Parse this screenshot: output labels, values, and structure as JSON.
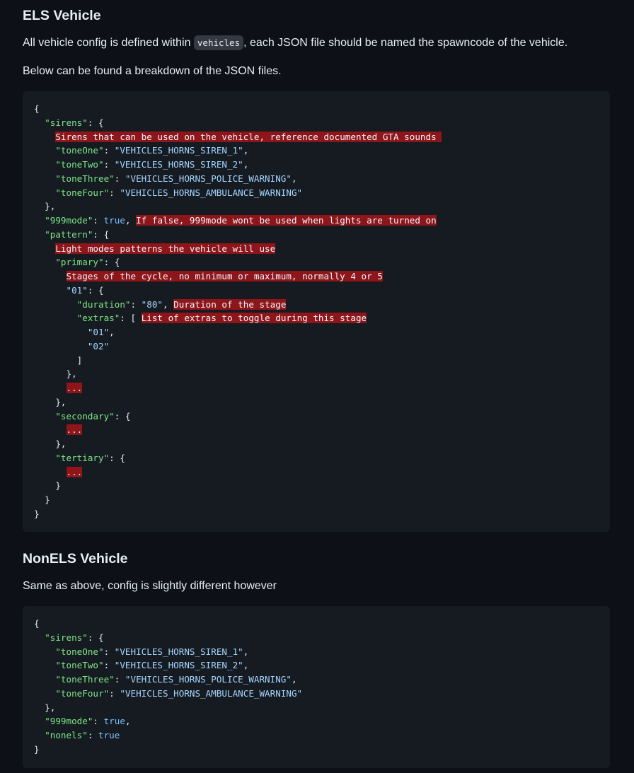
{
  "els": {
    "heading": "ELS Vehicle",
    "intro_before": "All vehicle config is defined within ",
    "intro_code": "vehicles",
    "intro_after": ", each JSON file should be named the spawncode of the vehicle.",
    "breakdown": "Below can be found a breakdown of the JSON files.",
    "code": [
      [
        [
          "p",
          "{"
        ]
      ],
      [
        [
          "p",
          "  "
        ],
        [
          "k",
          "\"sirens\""
        ],
        [
          "p",
          ": {"
        ]
      ],
      [
        [
          "p",
          "    "
        ],
        [
          "err",
          "Sirens that can be used on the vehicle, reference documented GTA sounds "
        ]
      ],
      [
        [
          "p",
          "    "
        ],
        [
          "k",
          "\"toneOne\""
        ],
        [
          "p",
          ": "
        ],
        [
          "s",
          "\"VEHICLES_HORNS_SIREN_1\""
        ],
        [
          "p",
          ","
        ]
      ],
      [
        [
          "p",
          "    "
        ],
        [
          "k",
          "\"toneTwo\""
        ],
        [
          "p",
          ": "
        ],
        [
          "s",
          "\"VEHICLES_HORNS_SIREN_2\""
        ],
        [
          "p",
          ","
        ]
      ],
      [
        [
          "p",
          "    "
        ],
        [
          "k",
          "\"toneThree\""
        ],
        [
          "p",
          ": "
        ],
        [
          "s",
          "\"VEHICLES_HORNS_POLICE_WARNING\""
        ],
        [
          "p",
          ","
        ]
      ],
      [
        [
          "p",
          "    "
        ],
        [
          "k",
          "\"toneFour\""
        ],
        [
          "p",
          ": "
        ],
        [
          "s",
          "\"VEHICLES_HORNS_AMBULANCE_WARNING\""
        ]
      ],
      [
        [
          "p",
          "  },"
        ]
      ],
      [
        [
          "p",
          "  "
        ],
        [
          "k",
          "\"999mode\""
        ],
        [
          "p",
          ": "
        ],
        [
          "c",
          "true"
        ],
        [
          "p",
          ", "
        ],
        [
          "err",
          "If false, 999mode wont be used when lights are turned on"
        ]
      ],
      [
        [
          "p",
          "  "
        ],
        [
          "k",
          "\"pattern\""
        ],
        [
          "p",
          ": {"
        ]
      ],
      [
        [
          "p",
          "    "
        ],
        [
          "err",
          "Light modes patterns the vehicle will use"
        ]
      ],
      [
        [
          "p",
          "    "
        ],
        [
          "k",
          "\"primary\""
        ],
        [
          "p",
          ": {"
        ]
      ],
      [
        [
          "p",
          "      "
        ],
        [
          "err",
          "Stages of the cycle, no minimum or maximum, normally 4 or 5"
        ]
      ],
      [
        [
          "p",
          "      "
        ],
        [
          "s",
          "\"01\""
        ],
        [
          "p",
          ": {"
        ]
      ],
      [
        [
          "p",
          "        "
        ],
        [
          "k",
          "\"duration\""
        ],
        [
          "p",
          ": "
        ],
        [
          "s",
          "\"80\""
        ],
        [
          "p",
          ", "
        ],
        [
          "err",
          "Duration of the stage"
        ]
      ],
      [
        [
          "p",
          "        "
        ],
        [
          "k",
          "\"extras\""
        ],
        [
          "p",
          ": [ "
        ],
        [
          "err",
          "List of extras to toggle during this stage"
        ]
      ],
      [
        [
          "p",
          "          "
        ],
        [
          "s",
          "\"01\""
        ],
        [
          "p",
          ","
        ]
      ],
      [
        [
          "p",
          "          "
        ],
        [
          "s",
          "\"02\""
        ]
      ],
      [
        [
          "p",
          "        ]"
        ]
      ],
      [
        [
          "p",
          "      },"
        ]
      ],
      [
        [
          "p",
          "      "
        ],
        [
          "err",
          "..."
        ]
      ],
      [
        [
          "p",
          "    },"
        ]
      ],
      [
        [
          "p",
          "    "
        ],
        [
          "k",
          "\"secondary\""
        ],
        [
          "p",
          ": {"
        ]
      ],
      [
        [
          "p",
          "      "
        ],
        [
          "err",
          "..."
        ]
      ],
      [
        [
          "p",
          "    },"
        ]
      ],
      [
        [
          "p",
          "    "
        ],
        [
          "k",
          "\"tertiary\""
        ],
        [
          "p",
          ": {"
        ]
      ],
      [
        [
          "p",
          "      "
        ],
        [
          "err",
          "..."
        ]
      ],
      [
        [
          "p",
          "    }"
        ]
      ],
      [
        [
          "p",
          "  }"
        ]
      ],
      [
        [
          "p",
          "}"
        ]
      ]
    ]
  },
  "nonels": {
    "heading": "NonELS Vehicle",
    "intro": "Same as above, config is slightly different however",
    "code": [
      [
        [
          "p",
          "{"
        ]
      ],
      [
        [
          "p",
          "  "
        ],
        [
          "k",
          "\"sirens\""
        ],
        [
          "p",
          ": {"
        ]
      ],
      [
        [
          "p",
          "    "
        ],
        [
          "k",
          "\"toneOne\""
        ],
        [
          "p",
          ": "
        ],
        [
          "s",
          "\"VEHICLES_HORNS_SIREN_1\""
        ],
        [
          "p",
          ","
        ]
      ],
      [
        [
          "p",
          "    "
        ],
        [
          "k",
          "\"toneTwo\""
        ],
        [
          "p",
          ": "
        ],
        [
          "s",
          "\"VEHICLES_HORNS_SIREN_2\""
        ],
        [
          "p",
          ","
        ]
      ],
      [
        [
          "p",
          "    "
        ],
        [
          "k",
          "\"toneThree\""
        ],
        [
          "p",
          ": "
        ],
        [
          "s",
          "\"VEHICLES_HORNS_POLICE_WARNING\""
        ],
        [
          "p",
          ","
        ]
      ],
      [
        [
          "p",
          "    "
        ],
        [
          "k",
          "\"toneFour\""
        ],
        [
          "p",
          ": "
        ],
        [
          "s",
          "\"VEHICLES_HORNS_AMBULANCE_WARNING\""
        ]
      ],
      [
        [
          "p",
          "  },"
        ]
      ],
      [
        [
          "p",
          "  "
        ],
        [
          "k",
          "\"999mode\""
        ],
        [
          "p",
          ": "
        ],
        [
          "c",
          "true"
        ],
        [
          "p",
          ","
        ]
      ],
      [
        [
          "p",
          "  "
        ],
        [
          "k",
          "\"nonels\""
        ],
        [
          "p",
          ": "
        ],
        [
          "c",
          "true"
        ]
      ],
      [
        [
          "p",
          "}"
        ]
      ]
    ]
  },
  "colors": {
    "background": "#0d1117",
    "code_background": "#161b22",
    "key": "#7ee787",
    "string": "#a5d6ff",
    "constant": "#79c0ff",
    "invalid_highlight": "#8e1519"
  }
}
